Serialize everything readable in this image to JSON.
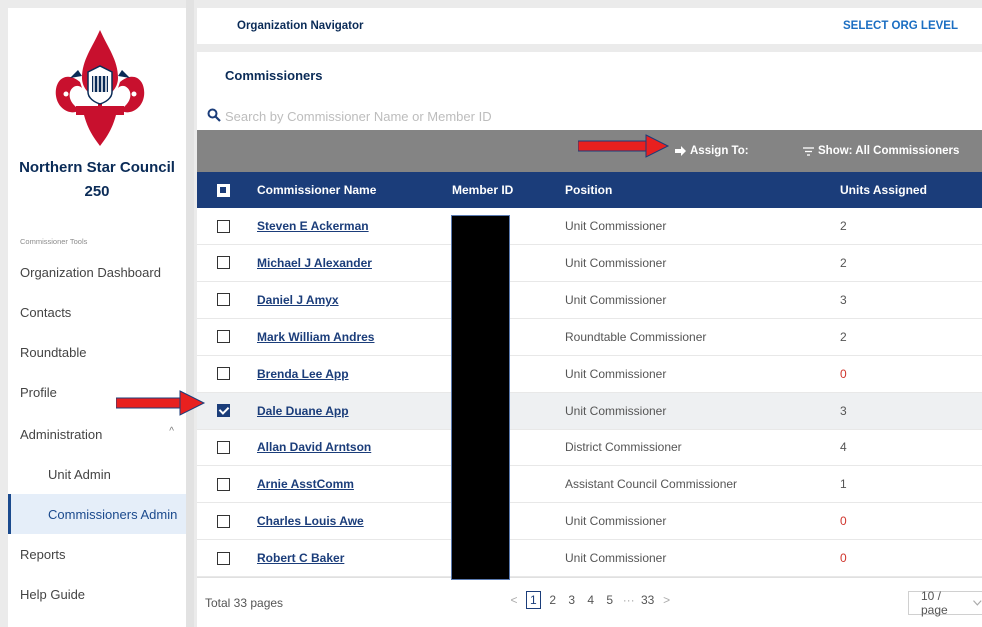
{
  "sidebar": {
    "council_name": "Northern Star Council 250",
    "tools_label": "Commissioner Tools",
    "items": [
      {
        "label": "Organization Dashboard"
      },
      {
        "label": "Contacts"
      },
      {
        "label": "Roundtable"
      },
      {
        "label": "Profile"
      },
      {
        "label": "Administration"
      },
      {
        "label": "Unit Admin"
      },
      {
        "label": "Commissioners Admin"
      },
      {
        "label": "Reports"
      },
      {
        "label": "Help Guide"
      }
    ],
    "administration_chevron": "^"
  },
  "topbar": {
    "title": "Organization Navigator",
    "select_level": "SELECT ORG LEVEL"
  },
  "panel": {
    "title": "Commissioners",
    "search_placeholder": "Search by Commissioner Name or Member ID",
    "assign_label": "Assign To:",
    "show_label": "Show: All Commissioners"
  },
  "table": {
    "columns": [
      "Commissioner Name",
      "Member ID",
      "Position",
      "Units Assigned"
    ],
    "rows": [
      {
        "name": "Steven E Ackerman",
        "position": "Unit Commissioner",
        "units": "2",
        "checked": false
      },
      {
        "name": "Michael J Alexander",
        "position": "Unit Commissioner",
        "units": "2",
        "checked": false
      },
      {
        "name": "Daniel J Amyx",
        "position": "Unit Commissioner",
        "units": "3",
        "checked": false
      },
      {
        "name": "Mark William Andres",
        "position": "Roundtable Commissioner",
        "units": "2",
        "checked": false
      },
      {
        "name": "Brenda Lee App",
        "position": "Unit Commissioner",
        "units": "0",
        "checked": false
      },
      {
        "name": "Dale Duane App",
        "position": "Unit Commissioner",
        "units": "3",
        "checked": true
      },
      {
        "name": "Allan David Arntson",
        "position": "District Commissioner",
        "units": "4",
        "checked": false
      },
      {
        "name": "Arnie AsstComm",
        "position": "Assistant Council Commissioner",
        "units": "1",
        "checked": false
      },
      {
        "name": "Charles Louis Awe",
        "position": "Unit Commissioner",
        "units": "0",
        "checked": false
      },
      {
        "name": "Robert C Baker",
        "position": "Unit Commissioner",
        "units": "0",
        "checked": false
      }
    ]
  },
  "footer": {
    "total": "Total 33 pages",
    "pages": [
      "1",
      "2",
      "3",
      "4",
      "5",
      "···",
      "33"
    ],
    "current_page": "1",
    "prev": "<",
    "next": ">",
    "per_page": "10 / page"
  },
  "colors": {
    "brand_navy": "#1b3d7a",
    "toolbar_gray": "#848484",
    "annotation_red": "#e8201f",
    "zero_units_red": "#d0342c"
  }
}
